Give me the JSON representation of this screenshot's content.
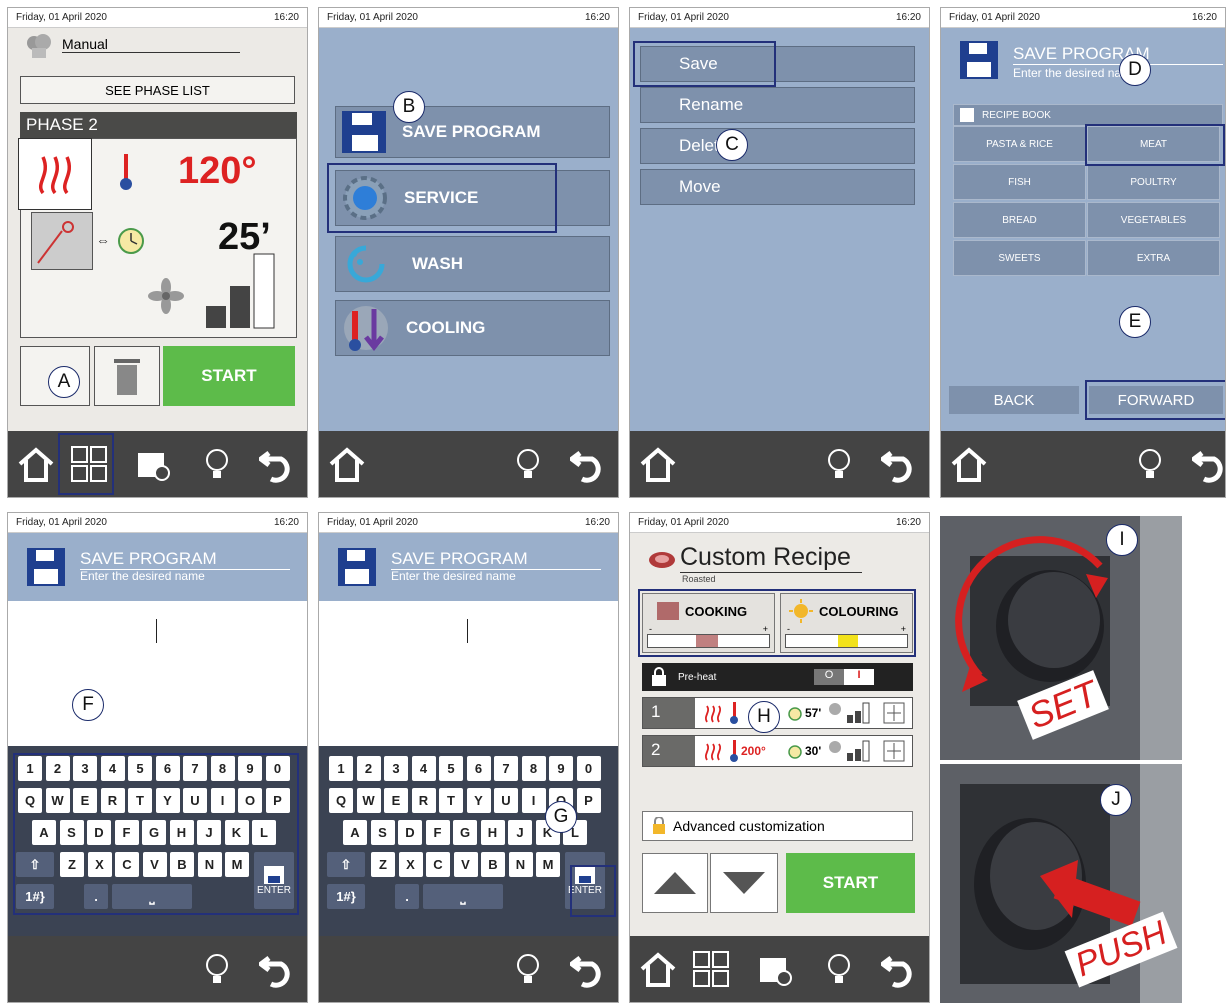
{
  "status": {
    "date": "Friday, 01 April 2020",
    "time": "16:20"
  },
  "callouts": {
    "a": "A",
    "b": "B",
    "c": "C",
    "d": "D",
    "e": "E",
    "f": "F",
    "g": "G",
    "h": "H",
    "i": "I",
    "j": "J"
  },
  "panel1": {
    "mode": "Manual",
    "see_phase_list": "SEE PHASE LIST",
    "phase": "PHASE 2",
    "temperature": "120°",
    "time": "25’",
    "start": "START"
  },
  "panel2": {
    "items": [
      {
        "label": "SAVE PROGRAM"
      },
      {
        "label": "SERVICE"
      },
      {
        "label": "WASH"
      },
      {
        "label": "COOLING"
      }
    ]
  },
  "panel3": {
    "items": [
      {
        "label": "Save"
      },
      {
        "label": "Rename"
      },
      {
        "label": "Delete"
      },
      {
        "label": "Move"
      }
    ]
  },
  "panel4": {
    "title": "SAVE PROGRAM",
    "subtitle": "Enter the desired name",
    "recipe_book": "RECIPE BOOK",
    "categories": [
      {
        "label": "PASTA & RICE"
      },
      {
        "label": "MEAT"
      },
      {
        "label": "FISH"
      },
      {
        "label": "POULTRY"
      },
      {
        "label": "BREAD"
      },
      {
        "label": "VEGETABLES"
      },
      {
        "label": "SWEETS"
      },
      {
        "label": "EXTRA"
      }
    ],
    "back": "BACK",
    "forward": "FORWARD"
  },
  "keyboard": {
    "title": "SAVE PROGRAM",
    "subtitle": "Enter the desired name",
    "row1": [
      "1",
      "2",
      "3",
      "4",
      "5",
      "6",
      "7",
      "8",
      "9",
      "0"
    ],
    "row2": [
      "Q",
      "W",
      "E",
      "R",
      "T",
      "Y",
      "U",
      "I",
      "O",
      "P"
    ],
    "row3": [
      "A",
      "S",
      "D",
      "F",
      "G",
      "H",
      "J",
      "K",
      "L"
    ],
    "row4": [
      "Z",
      "X",
      "C",
      "V",
      "B",
      "N",
      "M"
    ],
    "sym": "1#}",
    "dot": ".",
    "space": "⎵",
    "shift": "⇧",
    "enter": "ENTER"
  },
  "panel7": {
    "title": "Custom Recipe",
    "subtitle": "Roasted",
    "cooking": "COOKING",
    "colouring": "COLOURING",
    "minus": "-",
    "plus": "+",
    "preheat": "Pre-heat",
    "toggle_off": "O",
    "toggle_on": "I",
    "phases": [
      {
        "num": "1",
        "temp": "",
        "time": "57'"
      },
      {
        "num": "2",
        "temp": "200°",
        "time": "30'"
      }
    ],
    "advanced": "Advanced customization",
    "start": "START"
  },
  "photo": {
    "set": "SET",
    "push": "PUSH"
  }
}
